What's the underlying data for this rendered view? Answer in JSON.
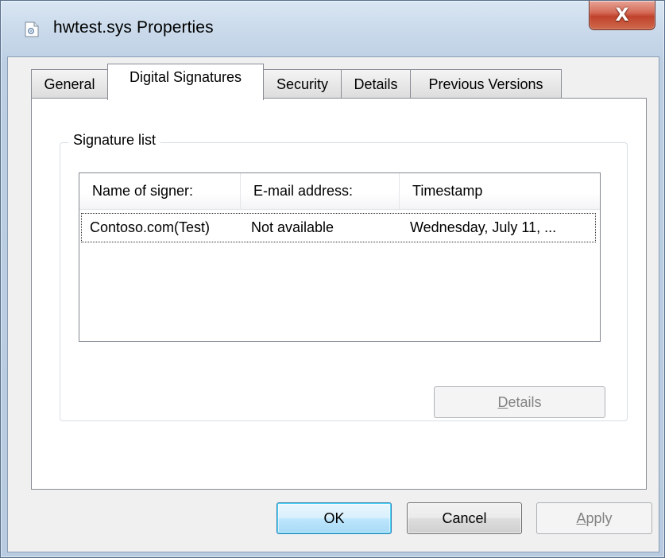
{
  "window": {
    "title": "hwtest.sys Properties",
    "close_glyph": "X"
  },
  "tabs": [
    {
      "label": "General",
      "active": false
    },
    {
      "label": "Digital Signatures",
      "active": true
    },
    {
      "label": "Security",
      "active": false
    },
    {
      "label": "Details",
      "active": false
    },
    {
      "label": "Previous Versions",
      "active": false
    }
  ],
  "signature_group": {
    "label": "Signature list",
    "columns": [
      "Name of signer:",
      "E-mail address:",
      "Timestamp"
    ],
    "rows": [
      {
        "name": "Contoso.com(Test)",
        "email": "Not available",
        "timestamp": "Wednesday, July 11, ..."
      }
    ],
    "details_button": {
      "accel": "D",
      "rest": "etails",
      "enabled": false
    }
  },
  "footer": {
    "ok": "OK",
    "cancel": "Cancel",
    "apply_accel": "A",
    "apply_rest": "pply",
    "apply_enabled": false
  },
  "colors": {
    "close_button": "#c0432c",
    "default_button_border": "#3c7fb1",
    "disabled_text": "#838383"
  }
}
